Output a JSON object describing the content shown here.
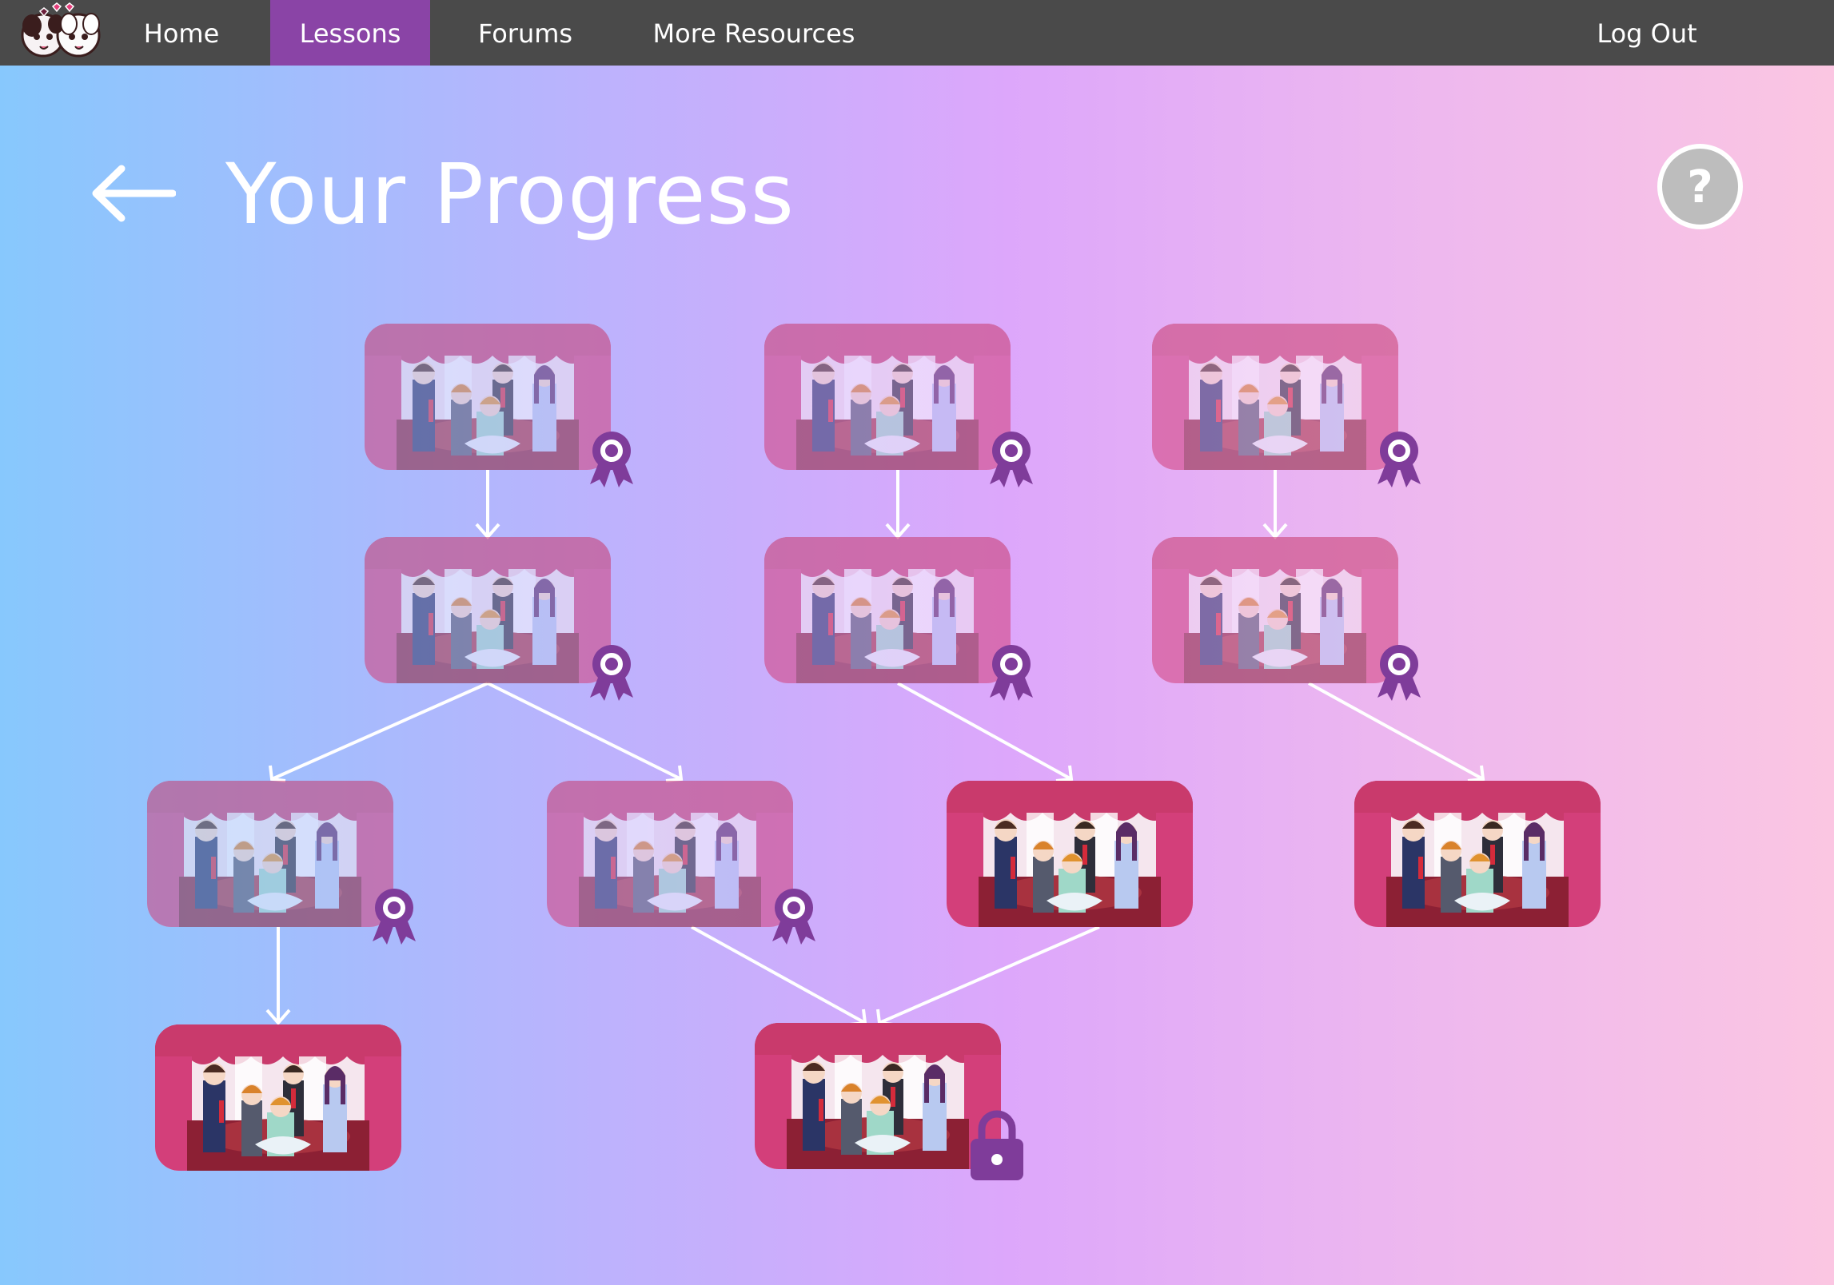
{
  "nav": {
    "items": [
      {
        "label": "Home",
        "active": false
      },
      {
        "label": "Lessons",
        "active": true
      },
      {
        "label": "Forums",
        "active": false
      },
      {
        "label": "More Resources",
        "active": false
      }
    ],
    "logout_label": "Log Out",
    "logo_icon": "twin-mascot-logo-icon"
  },
  "page": {
    "title": "Your Progress",
    "back_icon": "arrow-left-icon",
    "help_label": "?"
  },
  "colors": {
    "nav_bg": "#4a4a4a",
    "nav_active": "#8a44a6",
    "badge": "#7f3c9a",
    "gradient": [
      "#87c8fd",
      "#bdb2fd",
      "#dda7fb",
      "#fbc6e2"
    ]
  },
  "lessons": [
    {
      "id": "r1c1",
      "status": "completed",
      "icon": "ribbon-award-icon"
    },
    {
      "id": "r1c2",
      "status": "completed",
      "icon": "ribbon-award-icon"
    },
    {
      "id": "r1c3",
      "status": "completed",
      "icon": "ribbon-award-icon"
    },
    {
      "id": "r2c1",
      "status": "completed",
      "icon": "ribbon-award-icon"
    },
    {
      "id": "r2c2",
      "status": "completed",
      "icon": "ribbon-award-icon"
    },
    {
      "id": "r2c3",
      "status": "completed",
      "icon": "ribbon-award-icon"
    },
    {
      "id": "r3c1",
      "status": "completed",
      "icon": "ribbon-award-icon"
    },
    {
      "id": "r3c2",
      "status": "completed",
      "icon": "ribbon-award-icon"
    },
    {
      "id": "r3c3",
      "status": "available",
      "icon": ""
    },
    {
      "id": "r3c4",
      "status": "available",
      "icon": ""
    },
    {
      "id": "r4c1",
      "status": "available",
      "icon": ""
    },
    {
      "id": "r4c2",
      "status": "locked",
      "icon": "padlock-icon"
    }
  ]
}
